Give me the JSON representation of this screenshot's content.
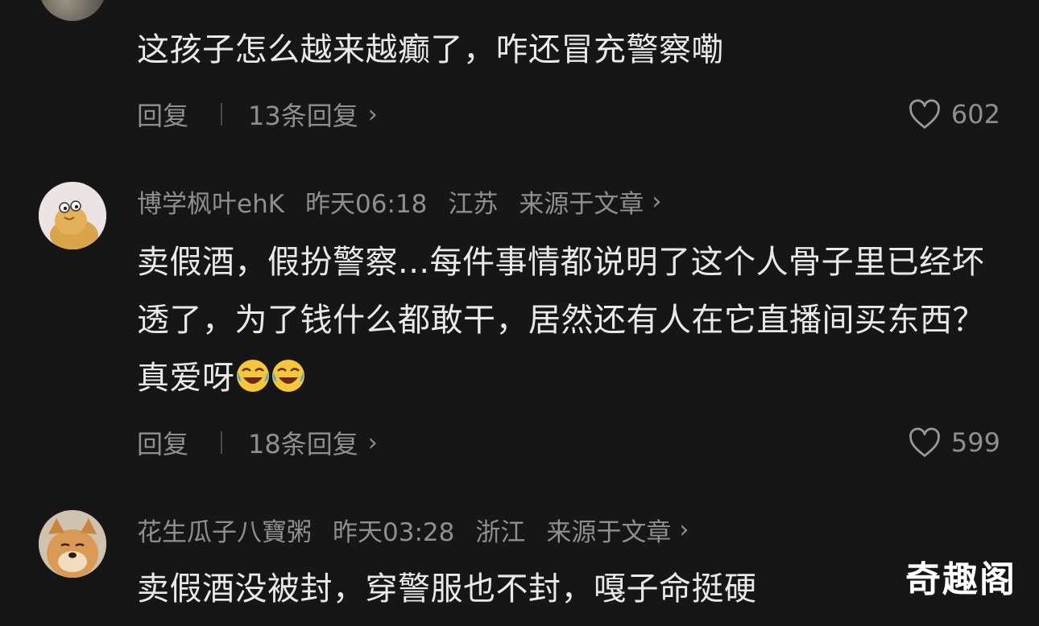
{
  "comments": [
    {
      "user": "",
      "time": "",
      "region": "",
      "source": "",
      "text": "这孩子怎么越来越癫了，咋还冒充警察嘞",
      "reply_label": "回复",
      "replies_label": "13条回复",
      "likes": "602"
    },
    {
      "user": "博学枫叶ehK",
      "time": "昨天06:18",
      "region": "江苏",
      "source": "来源于文章",
      "text": "卖假酒，假扮警察...每件事情都说明了这个人骨子里已经坏透了，为了钱什么都敢干，居然还有人在它直播间买东西？真爱呀",
      "reply_label": "回复",
      "replies_label": "18条回复",
      "likes": "599"
    },
    {
      "user": "花生瓜子八寶粥",
      "time": "昨天03:28",
      "region": "浙江",
      "source": "来源于文章",
      "text": "卖假酒没被封，穿警服也不封，嘎子命挺硬",
      "reply_label": "",
      "replies_label": "",
      "likes": ""
    }
  ],
  "watermark": "奇趣阁",
  "icons": {
    "chevron": "chevron-right-icon",
    "like": "heart-outline-icon",
    "emoji": "laughing-crying-emoji-icon"
  },
  "colors": {
    "background": "#161617",
    "text": "#e9e9ea",
    "muted": "#8f8f92"
  }
}
